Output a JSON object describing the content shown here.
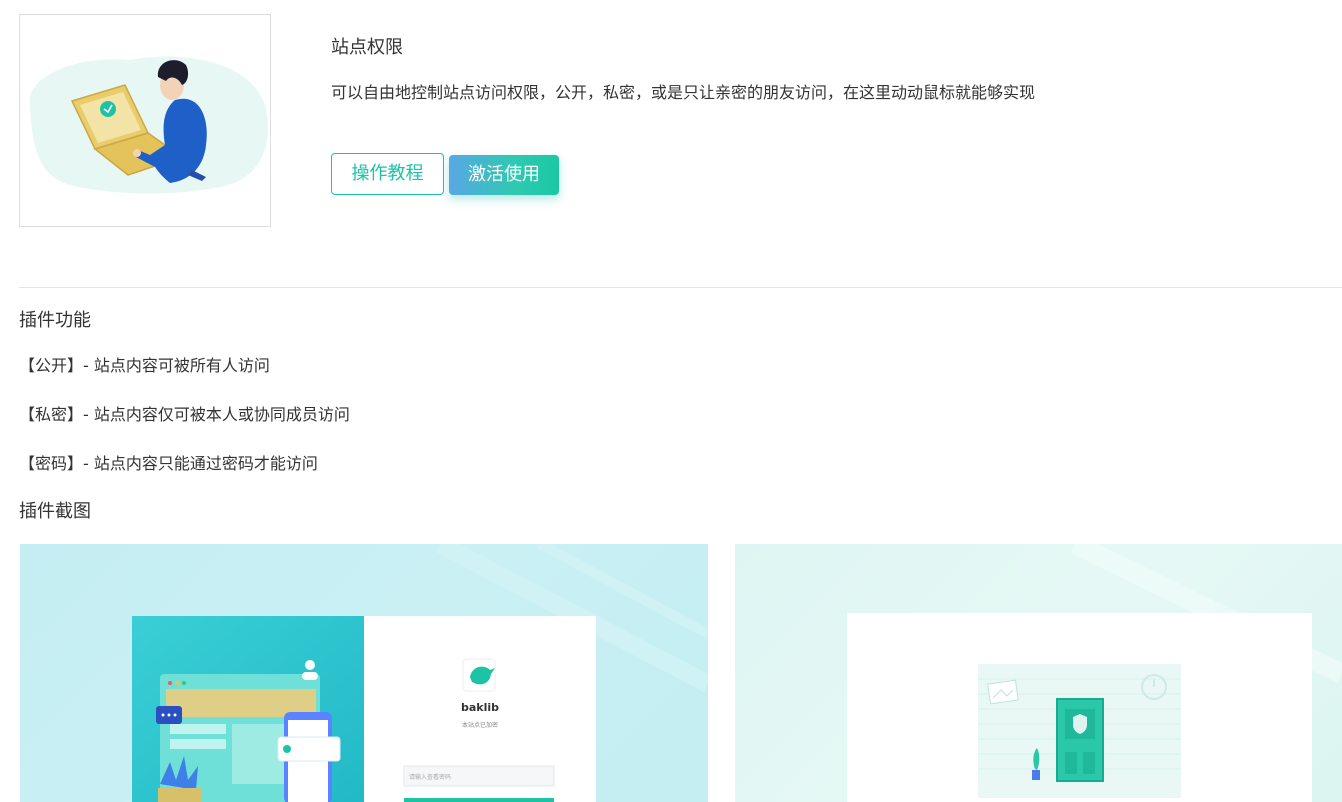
{
  "plugin": {
    "title": "站点权限",
    "description": "可以自由地控制站点访问权限，公开，私密，或是只让亲密的朋友访问，在这里动动鼠标就能够实现"
  },
  "buttons": {
    "tutorial": "操作教程",
    "activate": "激活使用"
  },
  "features": {
    "heading": "插件功能",
    "items": [
      "【公开】- 站点内容可被所有人访问",
      "【私密】- 站点内容仅可被本人或协同成员访问",
      "【密码】- 站点内容只能通过密码才能访问"
    ]
  },
  "screenshots": {
    "heading": "插件截图",
    "shot1": {
      "brand": "baklib",
      "subtitle": "本站点已加密",
      "password_placeholder": "请输入查看密码"
    }
  },
  "colors": {
    "accent": "#1cc3a5",
    "accent_blue": "#5aa7e6",
    "divider": "#e4e4e4"
  }
}
